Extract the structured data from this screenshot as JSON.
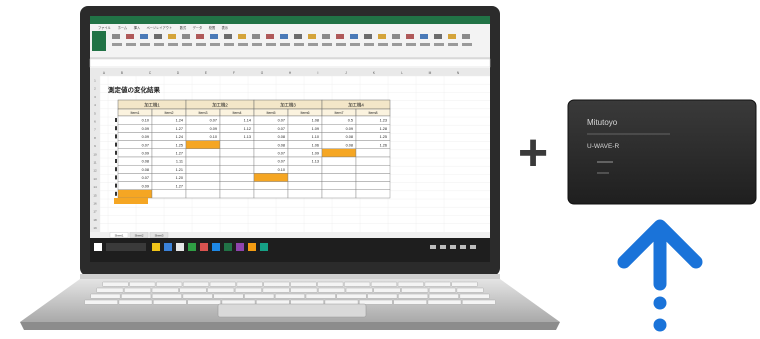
{
  "spreadsheet": {
    "title": "測定値の変化結果",
    "ribbon_tabs": [
      "ファイル",
      "ホーム",
      "挿入",
      "ページレイアウト",
      "数式",
      "データ",
      "校閲",
      "表示"
    ],
    "column_letters": [
      "A",
      "B",
      "C",
      "D",
      "E",
      "F",
      "G",
      "H",
      "I",
      "J",
      "K",
      "L",
      "M",
      "N"
    ],
    "groups": [
      {
        "header": "加工機1",
        "sub": [
          "Item1",
          "Item2"
        ],
        "rows": [
          [
            "0.10",
            "1.24"
          ],
          [
            "0.09",
            "1.27"
          ],
          [
            "0.09",
            "1.24"
          ],
          [
            "0.07",
            "1.25"
          ],
          [
            "0.09",
            "1.27"
          ],
          [
            "0.08",
            "1.11"
          ],
          [
            "0.08",
            "1.21"
          ],
          [
            "0.07",
            "1.20"
          ],
          [
            "0.09",
            "1.27"
          ]
        ]
      },
      {
        "header": "加工機2",
        "sub": [
          "Item3",
          "Item4"
        ],
        "rows": [
          [
            "0.07",
            "1.14"
          ],
          [
            "0.09",
            "1.12"
          ],
          [
            "0.10",
            "1.13"
          ]
        ]
      },
      {
        "header": "加工機3",
        "sub": [
          "Item5",
          "Item6"
        ],
        "rows": [
          [
            "0.07",
            "1.08"
          ],
          [
            "0.07",
            "1.09"
          ],
          [
            "0.08",
            "1.10"
          ],
          [
            "0.08",
            "1.06"
          ],
          [
            "0.07",
            "1.09"
          ],
          [
            "0.07",
            "1.13"
          ],
          [
            "0.10",
            ""
          ]
        ]
      },
      {
        "header": "加工機4",
        "sub": [
          "Item7",
          "Item8"
        ],
        "rows": [
          [
            "0.5",
            "1.23"
          ],
          [
            "0.09",
            "1.28"
          ],
          [
            "0.08",
            "1.25"
          ],
          [
            "0.08",
            "1.26"
          ]
        ]
      }
    ],
    "sheet_tabs": [
      "Sheet1",
      "Sheet2",
      "Sheet3"
    ]
  },
  "device": {
    "brand": "Mitutoyo",
    "label": "U-WAVE-R"
  },
  "plus_symbol": "+",
  "colors": {
    "arrow": "#1a73d9",
    "device_body": "#2b2b2b",
    "highlight_cell": "#f5a623",
    "excel_green": "#217346"
  }
}
